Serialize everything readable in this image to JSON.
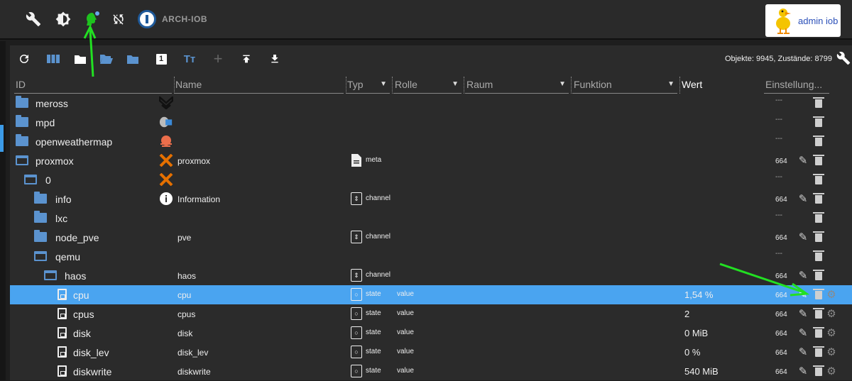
{
  "topbar": {
    "brand": "ARCH-IOB",
    "user_label": "admin iob",
    "icons": [
      "wrench-icon",
      "brightness-icon",
      "expert-mode-icon",
      "sync-icon"
    ]
  },
  "toolbar": {
    "stats": "Objekte: 9945, Zustände: 8799",
    "icons": [
      "refresh-icon",
      "columns-icon",
      "folder-icon",
      "folder-open-icon",
      "folder-blue-icon",
      "counter-icon",
      "text-format-icon",
      "add-icon",
      "upload-icon",
      "download-icon"
    ],
    "counter_label": "1",
    "text_format_label": "Tт",
    "add_label": "+"
  },
  "columns": {
    "id": "ID",
    "name": "Name",
    "typ": "Typ",
    "rolle": "Rolle",
    "raum": "Raum",
    "funktion": "Funktion",
    "wert": "Wert",
    "einstellung": "Einstellung..."
  },
  "rows": [
    {
      "id": "meross",
      "name": "",
      "typ": "",
      "role": "",
      "value": "",
      "acl": "---"
    },
    {
      "id": "mpd",
      "name": "",
      "typ": "",
      "role": "",
      "value": "",
      "acl": "---"
    },
    {
      "id": "openweathermap",
      "name": "",
      "typ": "",
      "role": "",
      "value": "",
      "acl": "---"
    },
    {
      "id": "proxmox",
      "name": "proxmox",
      "typ": "meta",
      "role": "",
      "value": "",
      "acl": "664"
    },
    {
      "id": "0",
      "name": "",
      "typ": "",
      "role": "",
      "value": "",
      "acl": "---"
    },
    {
      "id": "info",
      "name": "Information",
      "typ": "channel",
      "role": "",
      "value": "",
      "acl": "664"
    },
    {
      "id": "lxc",
      "name": "",
      "typ": "",
      "role": "",
      "value": "",
      "acl": "---"
    },
    {
      "id": "node_pve",
      "name": "pve",
      "typ": "channel",
      "role": "",
      "value": "",
      "acl": "664"
    },
    {
      "id": "qemu",
      "name": "",
      "typ": "",
      "role": "",
      "value": "",
      "acl": "---"
    },
    {
      "id": "haos",
      "name": "haos",
      "typ": "channel",
      "role": "",
      "value": "",
      "acl": "664"
    },
    {
      "id": "cpu",
      "name": "cpu",
      "typ": "state",
      "role": "value",
      "value": "1,54 %",
      "acl": "664"
    },
    {
      "id": "cpus",
      "name": "cpus",
      "typ": "state",
      "role": "value",
      "value": "2",
      "acl": "664"
    },
    {
      "id": "disk",
      "name": "disk",
      "typ": "state",
      "role": "value",
      "value": "0 MiB",
      "acl": "664"
    },
    {
      "id": "disk_lev",
      "name": "disk_lev",
      "typ": "state",
      "role": "value",
      "value": "0 %",
      "acl": "664"
    },
    {
      "id": "diskwrite",
      "name": "diskwrite",
      "typ": "state",
      "role": "value",
      "value": "540 MiB",
      "acl": "664"
    }
  ],
  "colors": {
    "selected_row": "#4aa4f0",
    "folder": "#5b93cf",
    "annotation_arrow": "#22e022",
    "expert_icon": "#1ec21e"
  }
}
